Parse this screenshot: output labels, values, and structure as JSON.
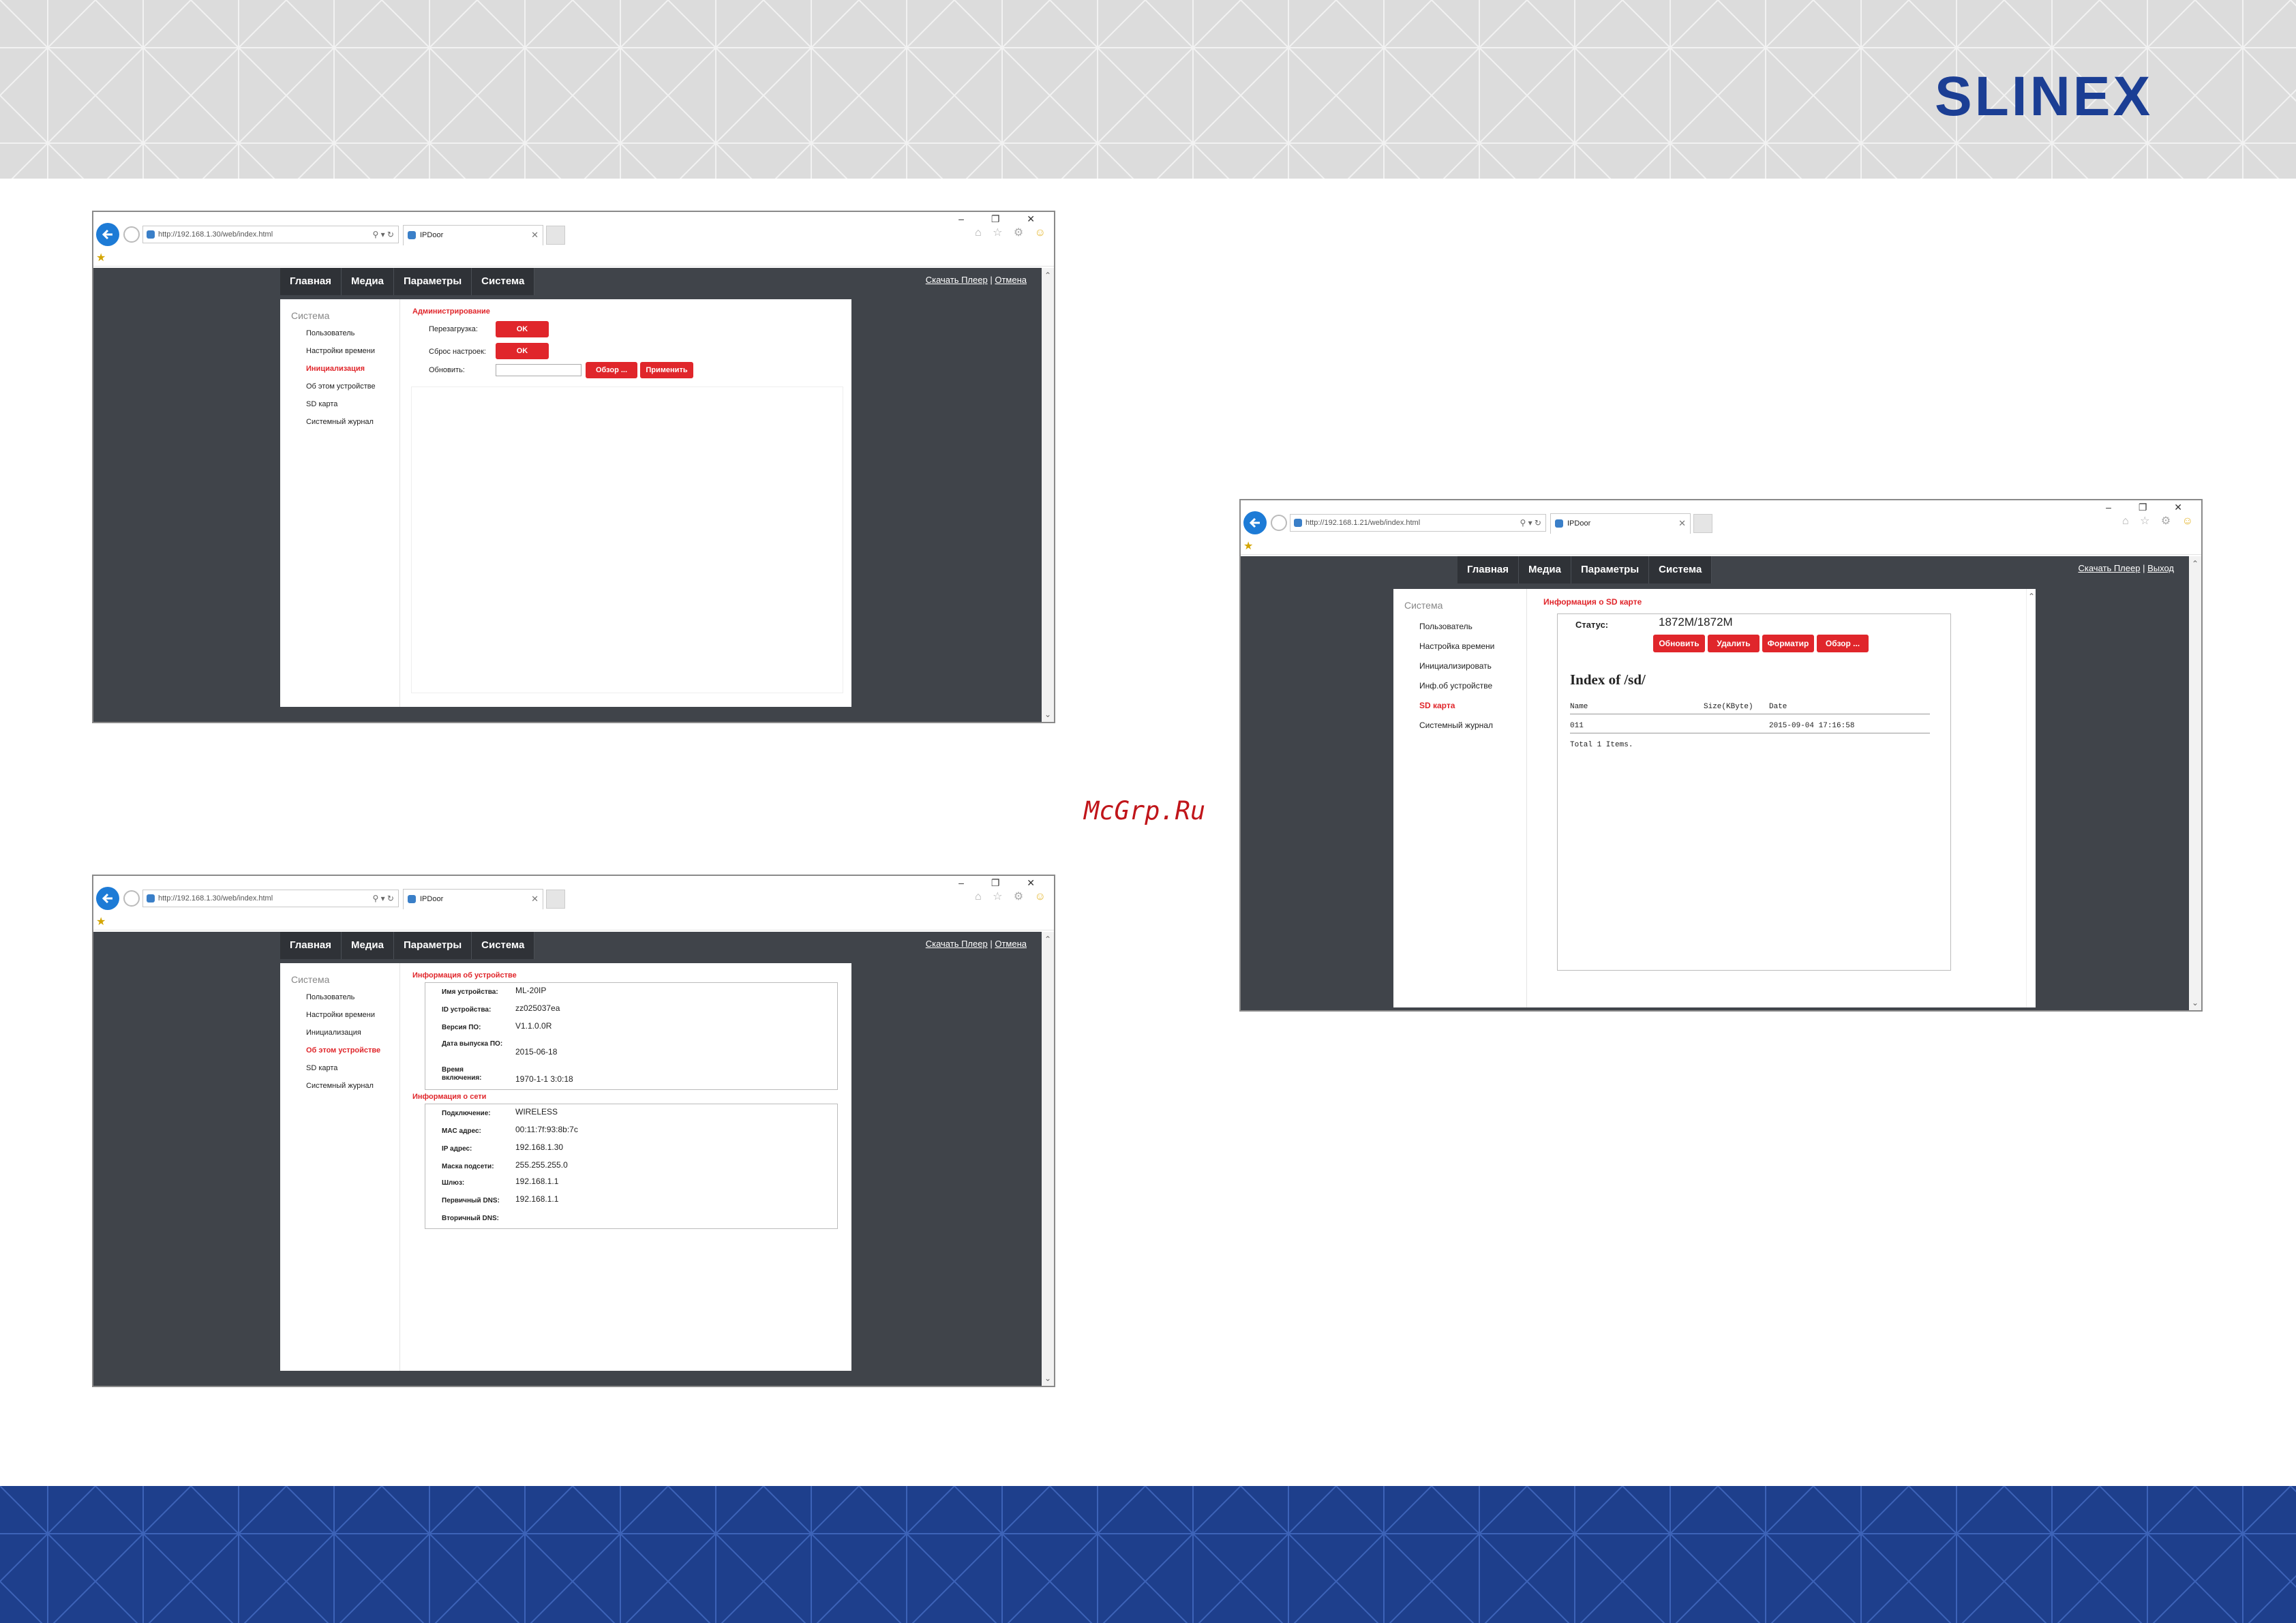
{
  "brand": {
    "logo": "SLINEX",
    "watermark": "McGrp.Ru"
  },
  "browser": {
    "window_controls": "–  ❐  ✕",
    "nav_icons": "⌂ ☆ ⚙",
    "smiley": "☺",
    "tab_title": "IPDoor",
    "addr_tools": "⚲ ▾ ↻",
    "url_a": "http://192.168.1.30/web/index.html",
    "url_b": "http://192.168.1.21/web/index.html"
  },
  "nav": {
    "home": "Главная",
    "media": "Медиа",
    "params": "Параметры",
    "system": "Система"
  },
  "toplinks": {
    "download": "Скачать Плеер",
    "sep": "|",
    "cancel": "Отмена",
    "logout": "Выход"
  },
  "win1": {
    "side_title": "Система",
    "side": [
      "Пользователь",
      "Настройки времени",
      "Инициализация",
      "Об этом устройстве",
      "SD карта",
      "Системный журнал"
    ],
    "section": "Администрирование",
    "reboot_label": "Перезагрузка:",
    "reset_label": "Сброс настроек:",
    "update_label": "Обновить:",
    "ok": "OK",
    "browse": "Обзор ...",
    "apply": "Применить"
  },
  "win2": {
    "side_title": "Система",
    "side": [
      "Пользователь",
      "Настройки времени",
      "Инициализация",
      "Об этом устройстве",
      "SD карта",
      "Системный журнал"
    ],
    "dev_section": "Информация об устройстве",
    "net_section": "Информация о сети",
    "device": [
      {
        "k": "Имя устройства:",
        "v": "ML-20IP"
      },
      {
        "k": "ID устройства:",
        "v": "zz025037ea"
      },
      {
        "k": "Версия ПО:",
        "v": "V1.1.0.0R"
      },
      {
        "k": "Дата выпуска ПО:",
        "v": "2015-06-18"
      },
      {
        "k": "Время включения:",
        "v": "1970-1-1 3:0:18"
      }
    ],
    "network": [
      {
        "k": "Подключение:",
        "v": "WIRELESS"
      },
      {
        "k": "MAC адрес:",
        "v": "00:11:7f:93:8b:7c"
      },
      {
        "k": "IP адрес:",
        "v": "192.168.1.30"
      },
      {
        "k": "Маска подсети:",
        "v": "255.255.255.0"
      },
      {
        "k": "Шлюз:",
        "v": "192.168.1.1"
      },
      {
        "k": "Первичный DNS:",
        "v": "192.168.1.1"
      },
      {
        "k": "Вторичный DNS:",
        "v": ""
      }
    ]
  },
  "win3": {
    "side_title": "Система",
    "side": [
      "Пользователь",
      "Настройка времени",
      "Инициализировать",
      "Инф.об устройстве",
      "SD карта",
      "Системный журнал"
    ],
    "section": "Информация о SD карте",
    "status_label": "Статус:",
    "status_value": "1872M/1872M",
    "buttons": [
      "Обновить",
      "Удалить",
      "Форматир",
      "Обзор ..."
    ],
    "index_title": "Index of /sd/",
    "cols": [
      "Name",
      "Size(KByte)",
      "Date"
    ],
    "row": {
      "name": "011",
      "size": "",
      "date": "2015-09-04 17:16:58"
    },
    "total": "Total 1 Items."
  }
}
